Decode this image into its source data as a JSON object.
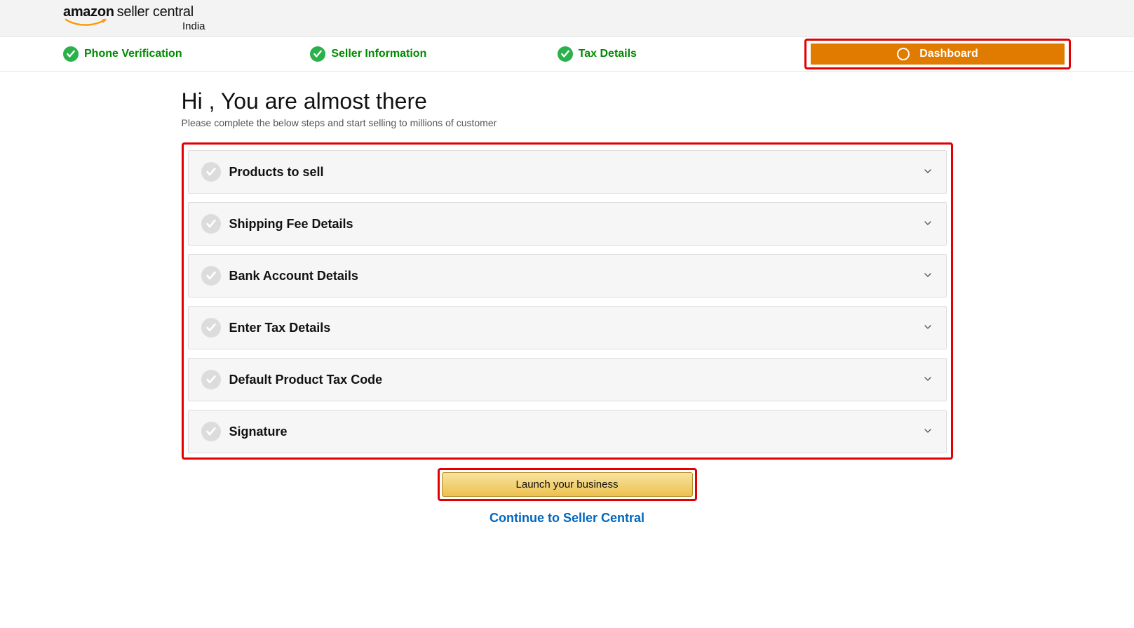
{
  "brand": {
    "word1": "amazon",
    "word2": "seller central",
    "region": "India"
  },
  "steps": {
    "phone": "Phone Verification",
    "seller": "Seller Information",
    "tax": "Tax Details",
    "dashboard": "Dashboard"
  },
  "main": {
    "title": "Hi , You are almost there",
    "subtitle": "Please complete the below steps and start selling to millions of customer"
  },
  "accordion": [
    {
      "label": "Products to sell"
    },
    {
      "label": "Shipping Fee Details"
    },
    {
      "label": "Bank Account Details"
    },
    {
      "label": "Enter Tax Details"
    },
    {
      "label": "Default Product Tax Code"
    },
    {
      "label": "Signature"
    }
  ],
  "actions": {
    "launch": "Launch your business",
    "continue": "Continue to Seller Central"
  }
}
